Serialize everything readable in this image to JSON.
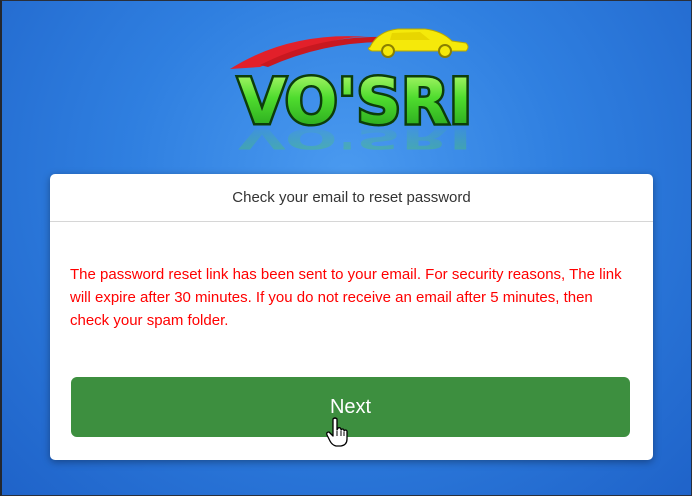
{
  "logo": {
    "text": "VO'SRI",
    "icon": "car-logo-icon"
  },
  "card": {
    "header": "Check your email to reset password",
    "message": "The password reset link has been sent to your email. For security reasons, The link will expire after 30 minutes. If you do not receive an email after 5 minutes, then check your spam folder.",
    "next_label": "Next"
  },
  "colors": {
    "background": "#2f7fe0",
    "message_text": "#ff0000",
    "button": "#3d8f3f",
    "logo_text": "#3fd33f",
    "swoosh": "#e2202a",
    "car": "#f5e90a"
  },
  "cursor": {
    "icon": "hand-pointer-icon"
  }
}
